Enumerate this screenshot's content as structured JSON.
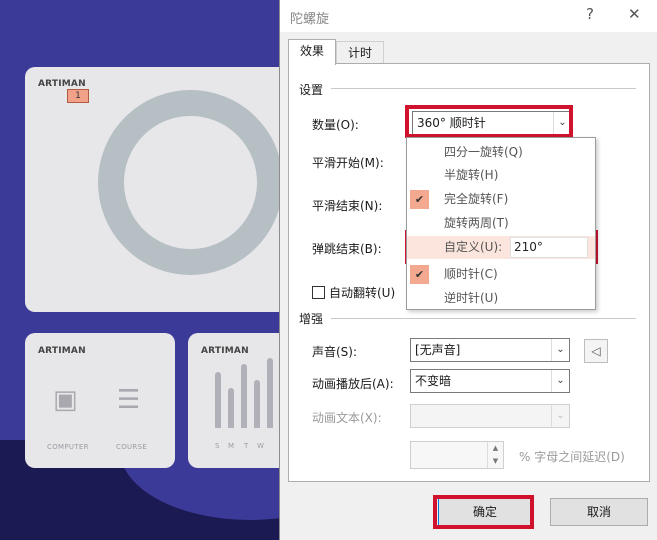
{
  "background": {
    "card1_title": "ARTIMAN",
    "anim_badge": "1",
    "card2_title": "ARTIMAN",
    "card3_title": "ARTIMAN",
    "computer_label": "COMPUTER",
    "course_label": "COURSE",
    "chart_days": [
      "S",
      "M",
      "T",
      "W"
    ]
  },
  "dialog": {
    "title": "陀螺旋",
    "help": "?",
    "close": "✕",
    "tabs": [
      "效果",
      "计时"
    ],
    "settings_group": "设置",
    "amount_label": "数量(O):",
    "amount_value": "360° 顺时针",
    "smooth_start_label": "平滑开始(M):",
    "smooth_end_label": "平滑结束(N):",
    "bounce_end_label": "弹跳结束(B):",
    "auto_reverse_label": "自动翻转(U)",
    "dropdown": {
      "items": [
        "四分一旋转(Q)",
        "半旋转(H)",
        "完全旋转(F)",
        "旋转两周(T)"
      ],
      "custom_label": "自定义(U):",
      "custom_value": "210°",
      "direction_items": [
        "顺时针(C)",
        "逆时针(U)"
      ]
    },
    "enhance_group": "增强",
    "sound_label": "声音(S):",
    "sound_value": "[无声音]",
    "after_anim_label": "动画播放后(A):",
    "after_anim_value": "不变暗",
    "anim_text_label": "动画文本(X):",
    "anim_text_value": "",
    "delay_label": "% 字母之间延迟(D)",
    "ok": "确定",
    "cancel": "取消"
  },
  "colors": {
    "highlight": "#d0122d",
    "selected_check": "#f2a98f",
    "slide_bg": "#3c3a98"
  }
}
